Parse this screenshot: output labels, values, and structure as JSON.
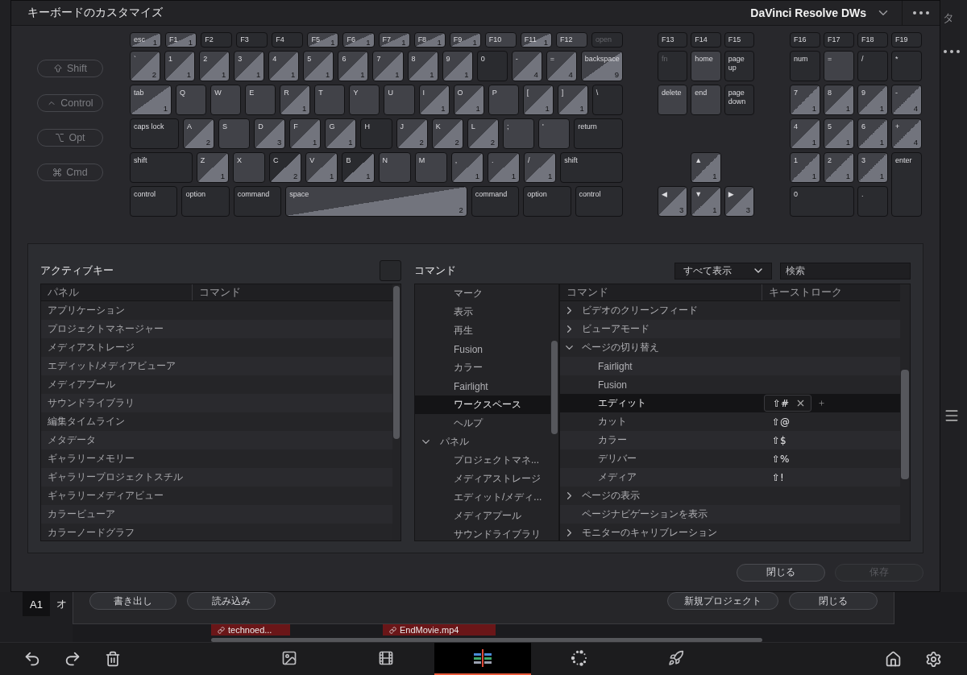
{
  "dialog": {
    "title": "キーボードのカスタマイズ",
    "preset": "DaVinci Resolve DWs",
    "modifiers": [
      {
        "kind": "shift",
        "label": "Shift"
      },
      {
        "kind": "control",
        "label": "Control"
      },
      {
        "kind": "option",
        "label": "Opt"
      },
      {
        "kind": "command",
        "label": "Cmd"
      }
    ],
    "keyboard": {
      "main_rows": [
        {
          "keys": [
            {
              "label": "esc",
              "kind": "lit",
              "count": "1"
            },
            {
              "label": "F1",
              "kind": "lit",
              "count": "1"
            },
            {
              "label": "F2",
              "kind": "plain"
            },
            {
              "label": "F3",
              "kind": "plain"
            },
            {
              "label": "F4",
              "kind": "plain"
            },
            {
              "label": "F5",
              "kind": "lit",
              "count": "1"
            },
            {
              "label": "F6",
              "kind": "lit",
              "count": "1"
            },
            {
              "label": "F7",
              "kind": "lit",
              "count": "1"
            },
            {
              "label": "F8",
              "kind": "lit",
              "count": "1"
            },
            {
              "label": "F9",
              "kind": "lit",
              "count": "1"
            },
            {
              "label": "F10",
              "kind": "lit"
            },
            {
              "label": "F11",
              "kind": "lit",
              "count": "1"
            },
            {
              "label": "F12",
              "kind": "lit"
            },
            {
              "label": "open",
              "kind": "dim"
            }
          ]
        },
        {
          "keys": [
            {
              "label": "`",
              "kind": "lit",
              "count": "2"
            },
            {
              "label": "1",
              "kind": "lit",
              "count": "1"
            },
            {
              "label": "2",
              "kind": "lit",
              "count": "1"
            },
            {
              "label": "3",
              "kind": "lit",
              "count": "1"
            },
            {
              "label": "4",
              "kind": "lit",
              "count": "1"
            },
            {
              "label": "5",
              "kind": "lit",
              "count": "1"
            },
            {
              "label": "6",
              "kind": "lit",
              "count": "1"
            },
            {
              "label": "7",
              "kind": "lit",
              "count": "1"
            },
            {
              "label": "8",
              "kind": "lit",
              "count": "1"
            },
            {
              "label": "9",
              "kind": "lit",
              "count": "1"
            },
            {
              "label": "0",
              "kind": "plain"
            },
            {
              "label": "-",
              "kind": "lit",
              "count": "4"
            },
            {
              "label": "=",
              "kind": "lit",
              "count": "4"
            },
            {
              "label": "backspace",
              "kind": "lit",
              "count": "9"
            }
          ]
        },
        {
          "keys": [
            {
              "label": "tab",
              "kind": "lit",
              "count": "1"
            },
            {
              "label": "Q",
              "kind": "lit"
            },
            {
              "label": "W",
              "kind": "lit"
            },
            {
              "label": "E",
              "kind": "lit"
            },
            {
              "label": "R",
              "kind": "lit",
              "count": "1"
            },
            {
              "label": "T",
              "kind": "lit"
            },
            {
              "label": "Y",
              "kind": "lit"
            },
            {
              "label": "U",
              "kind": "lit"
            },
            {
              "label": "I",
              "kind": "lit",
              "count": "1"
            },
            {
              "label": "O",
              "kind": "lit",
              "count": "1"
            },
            {
              "label": "P",
              "kind": "lit"
            },
            {
              "label": "[",
              "kind": "lit",
              "count": "1"
            },
            {
              "label": "]",
              "kind": "lit",
              "count": "1"
            },
            {
              "label": "\\",
              "kind": "plain"
            }
          ]
        },
        {
          "keys": [
            {
              "label": "caps lock",
              "kind": "plain"
            },
            {
              "label": "A",
              "kind": "lit",
              "count": "2"
            },
            {
              "label": "S",
              "kind": "lit"
            },
            {
              "label": "D",
              "kind": "lit",
              "count": "3"
            },
            {
              "label": "F",
              "kind": "lit",
              "count": "1"
            },
            {
              "label": "G",
              "kind": "lit",
              "count": "1"
            },
            {
              "label": "H",
              "kind": "plain"
            },
            {
              "label": "J",
              "kind": "lit",
              "count": "2"
            },
            {
              "label": "K",
              "kind": "lit",
              "count": "2"
            },
            {
              "label": "L",
              "kind": "lit",
              "count": "2"
            },
            {
              "label": ";",
              "kind": "lit"
            },
            {
              "label": "'",
              "kind": "lit"
            },
            {
              "label": "return",
              "kind": "plain"
            }
          ]
        },
        {
          "keys": [
            {
              "label": "shift",
              "kind": "plain"
            },
            {
              "label": "Z",
              "kind": "lit",
              "count": "1"
            },
            {
              "label": "X",
              "kind": "lit"
            },
            {
              "label": "C",
              "kind": "plain",
              "count": "2"
            },
            {
              "label": "V",
              "kind": "lit",
              "count": "1"
            },
            {
              "label": "B",
              "kind": "plain",
              "count": "1"
            },
            {
              "label": "N",
              "kind": "lit"
            },
            {
              "label": "M",
              "kind": "lit"
            },
            {
              "label": ",",
              "kind": "lit",
              "count": "1"
            },
            {
              "label": ".",
              "kind": "lit",
              "count": "1"
            },
            {
              "label": "/",
              "kind": "lit",
              "count": "1"
            },
            {
              "label": "shift",
              "kind": "plain"
            }
          ]
        },
        {
          "keys": [
            {
              "label": "control",
              "kind": "plain"
            },
            {
              "label": "option",
              "kind": "plain"
            },
            {
              "label": "command",
              "kind": "plain"
            },
            {
              "label": "space",
              "kind": "lit",
              "count": "2"
            },
            {
              "label": "command",
              "kind": "plain"
            },
            {
              "label": "option",
              "kind": "plain"
            },
            {
              "label": "control",
              "kind": "plain"
            }
          ]
        }
      ],
      "nav_keys": [
        {
          "label": "F13",
          "kind": "plain"
        },
        {
          "label": "F14",
          "kind": "plain"
        },
        {
          "label": "F15",
          "kind": "plain"
        },
        {
          "label": "fn",
          "kind": "dim"
        },
        {
          "label": "home",
          "kind": "lit"
        },
        {
          "label": "page up",
          "kind": "plain"
        },
        {
          "label": "delete",
          "kind": "lit"
        },
        {
          "label": "end",
          "kind": "lit"
        },
        {
          "label": "page down",
          "kind": "plain"
        },
        {
          "label": "▲",
          "kind": "lit",
          "count": "1"
        },
        {
          "label": "◀",
          "kind": "lit",
          "count": "3"
        },
        {
          "label": "▼",
          "kind": "lit",
          "count": "1"
        },
        {
          "label": "▶",
          "kind": "lit",
          "count": "3"
        }
      ],
      "numpad_keys": [
        {
          "label": "F16",
          "kind": "plain"
        },
        {
          "label": "F17",
          "kind": "plain"
        },
        {
          "label": "F18",
          "kind": "plain"
        },
        {
          "label": "F19",
          "kind": "plain"
        },
        {
          "label": "num",
          "kind": "plain"
        },
        {
          "label": "=",
          "kind": "lit"
        },
        {
          "label": "/",
          "kind": "plain"
        },
        {
          "label": "*",
          "kind": "plain"
        },
        {
          "label": "7",
          "kind": "lit",
          "count": "1"
        },
        {
          "label": "8",
          "kind": "lit",
          "count": "1"
        },
        {
          "label": "9",
          "kind": "lit",
          "count": "1"
        },
        {
          "label": "-",
          "kind": "lit",
          "count": "4"
        },
        {
          "label": "4",
          "kind": "lit",
          "count": "1"
        },
        {
          "label": "5",
          "kind": "lit",
          "count": "1"
        },
        {
          "label": "6",
          "kind": "lit",
          "count": "1"
        },
        {
          "label": "+",
          "kind": "lit",
          "count": "4"
        },
        {
          "label": "1",
          "kind": "lit",
          "count": "1"
        },
        {
          "label": "2",
          "kind": "lit",
          "count": "1"
        },
        {
          "label": "3",
          "kind": "lit",
          "count": "1"
        },
        {
          "label": "enter",
          "kind": "plain"
        },
        {
          "label": "0",
          "kind": "plain"
        },
        {
          "label": ".",
          "kind": "plain"
        }
      ]
    },
    "active_keys": {
      "title": "アクティブキー",
      "columns": [
        "パネル",
        "コマンド"
      ],
      "rows": [
        "アプリケーション",
        "プロジェクトマネージャー",
        "メディアストレージ",
        "エディット/メディアビューア",
        "メディアプール",
        "サウンドライブラリ",
        "編集タイムライン",
        "メタデータ",
        "ギャラリーメモリー",
        "ギャラリープロジェクトスチル",
        "ギャラリーメディアビュー",
        "カラービューア",
        "カラーノードグラフ"
      ]
    },
    "commands": {
      "title": "コマンド",
      "filter": "すべて表示",
      "search": {
        "placeholder": "検索"
      },
      "tree": {
        "scrolled_parent_children": [
          {
            "label": "マーク",
            "selected": false
          },
          {
            "label": "表示",
            "selected": false
          },
          {
            "label": "再生",
            "selected": false
          },
          {
            "label": "Fusion",
            "selected": false
          },
          {
            "label": "カラー",
            "selected": false
          },
          {
            "label": "Fairlight",
            "selected": false
          },
          {
            "label": "ワークスペース",
            "selected": true
          },
          {
            "label": "ヘルプ",
            "selected": false
          }
        ],
        "nodes": [
          {
            "label": "パネル",
            "expanded": true,
            "selected": false,
            "children": [
              {
                "label": "プロジェクトマネ...",
                "selected": false
              },
              {
                "label": "メディアストレージ",
                "selected": false
              },
              {
                "label": "エディット/メディ...",
                "selected": false
              },
              {
                "label": "メディアプール",
                "selected": false
              },
              {
                "label": "サウンドライブラリ",
                "selected": false
              }
            ]
          }
        ]
      },
      "columns": [
        "コマンド",
        "キーストローク"
      ],
      "rows": [
        {
          "kind": "group",
          "label": "ビデオのクリーンフィード",
          "expanded": false,
          "selected": false
        },
        {
          "kind": "group",
          "label": "ビューアモード",
          "expanded": false,
          "selected": false
        },
        {
          "kind": "group",
          "label": "ページの切り替え",
          "expanded": true,
          "selected": false,
          "children": [
            {
              "kind": "command",
              "label": "Fairlight",
              "selected": false
            },
            {
              "kind": "command",
              "label": "Fusion",
              "selected": false
            },
            {
              "kind": "command",
              "label": "エディット",
              "keystroke": "⇧#",
              "selected": true
            },
            {
              "kind": "command",
              "label": "カット",
              "keystroke": "⇧@",
              "selected": false
            },
            {
              "kind": "command",
              "label": "カラー",
              "keystroke": "⇧$",
              "selected": false
            },
            {
              "kind": "command",
              "label": "デリバー",
              "keystroke": "⇧%",
              "selected": false
            },
            {
              "kind": "command",
              "label": "メディア",
              "keystroke": "⇧!",
              "selected": false
            }
          ]
        },
        {
          "kind": "group",
          "label": "ページの表示",
          "expanded": false,
          "selected": false
        },
        {
          "kind": "command",
          "label": "ページナビゲーションを表示",
          "selected": false
        },
        {
          "kind": "group",
          "label": "モニターのキャリブレーション",
          "expanded": false,
          "selected": false
        }
      ]
    },
    "buttons": [
      {
        "label": "閉じる",
        "disabled": false
      },
      {
        "label": "保存",
        "disabled": true
      }
    ]
  },
  "background": {
    "sidebar_fragment": "タ",
    "track": {
      "label": "A1",
      "name_fragment": "オ"
    },
    "project_buttons": [
      "書き出し",
      "読み込み",
      "新規プロジェクト",
      "閉じる"
    ],
    "clips": [
      "technoed...",
      "EndMovie.mp4"
    ],
    "toolbar": {
      "pages": [
        {
          "kind": "media",
          "selected": false
        },
        {
          "kind": "cut",
          "selected": false
        },
        {
          "kind": "edit",
          "selected": true
        },
        {
          "kind": "color",
          "selected": false
        },
        {
          "kind": "deliver",
          "selected": false
        }
      ]
    }
  }
}
